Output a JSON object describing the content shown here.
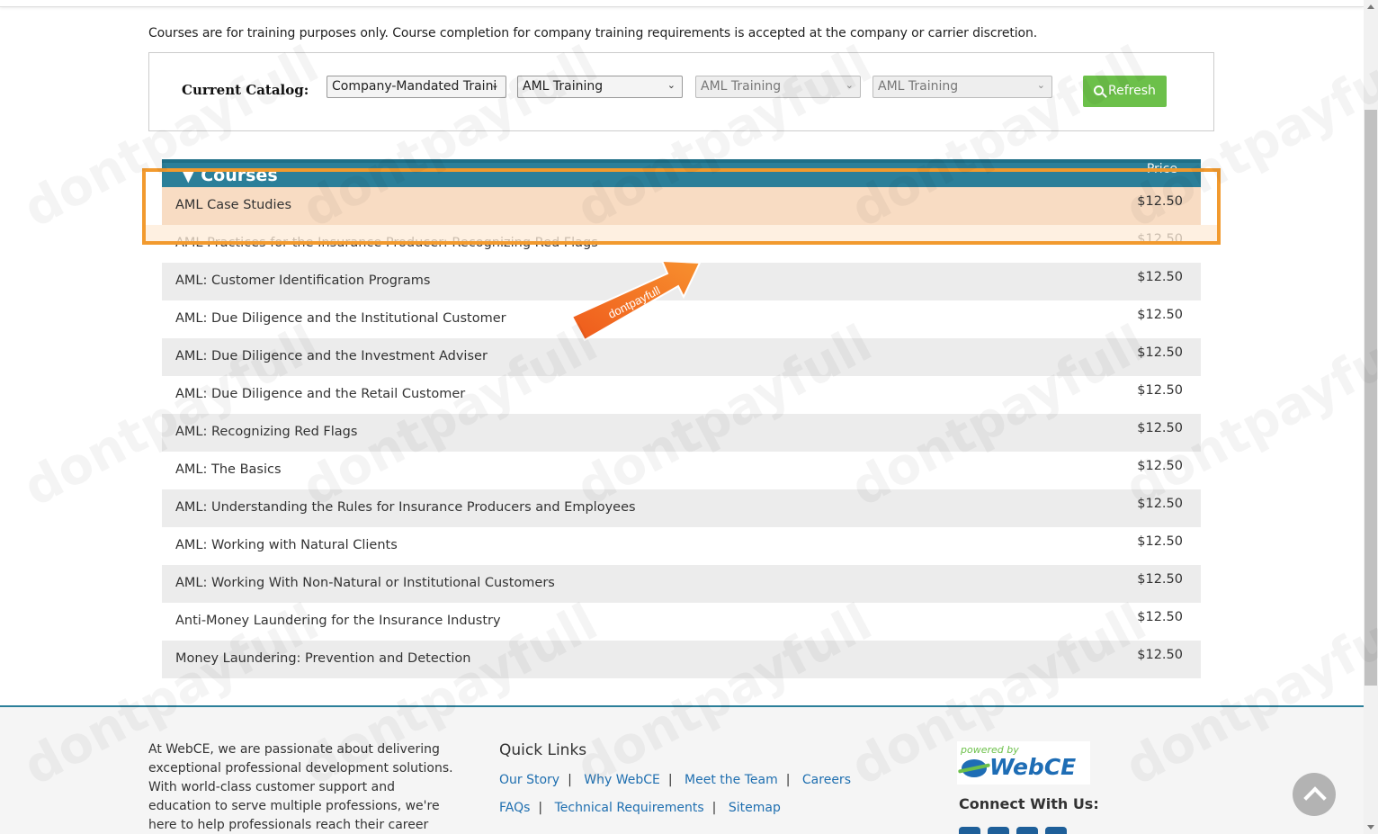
{
  "disclaimer": "Courses are for training purposes only. Course completion for company training requirements is accepted at the company or carrier discretion.",
  "catalog": {
    "label": "Current Catalog:",
    "selects": [
      {
        "value": "Company-Mandated Traini",
        "disabled": false
      },
      {
        "value": "AML Training",
        "disabled": false
      },
      {
        "value": "AML Training",
        "disabled": true
      },
      {
        "value": "AML Training",
        "disabled": true
      }
    ],
    "refresh_label": "Refresh"
  },
  "courses": {
    "title": "▼ Courses",
    "price_header": "Price",
    "items": [
      {
        "name": "AML Case Studies",
        "price": "$12.50"
      },
      {
        "name": "AML Practices for the Insurance Producer: Recognizing Red Flags",
        "price": "$12.50"
      },
      {
        "name": "AML: Customer Identification Programs",
        "price": "$12.50"
      },
      {
        "name": "AML: Due Diligence and the Institutional Customer",
        "price": "$12.50"
      },
      {
        "name": "AML: Due Diligence and the Investment Adviser",
        "price": "$12.50"
      },
      {
        "name": "AML: Due Diligence and the Retail Customer",
        "price": "$12.50"
      },
      {
        "name": "AML: Recognizing Red Flags",
        "price": "$12.50"
      },
      {
        "name": "AML: The Basics",
        "price": "$12.50"
      },
      {
        "name": "AML: Understanding the Rules for Insurance Producers and Employees",
        "price": "$12.50"
      },
      {
        "name": "AML: Working with Natural Clients",
        "price": "$12.50"
      },
      {
        "name": "AML: Working With Non-Natural or Institutional Customers",
        "price": "$12.50"
      },
      {
        "name": "Anti-Money Laundering for the Insurance Industry",
        "price": "$12.50"
      },
      {
        "name": "Money Laundering: Prevention and Detection",
        "price": "$12.50"
      }
    ]
  },
  "arrow_label": "dontpayfull",
  "watermark": "dontpayfull",
  "footer": {
    "about": "At WebCE, we are passionate about delivering exceptional professional development solutions. With world-class customer support and education to serve multiple professions, we're here to help professionals reach their career goals.",
    "quick_links_title": "Quick Links",
    "links_row1": [
      "Our Story",
      "Why WebCE",
      "Meet the Team",
      "Careers"
    ],
    "links_row2": [
      "FAQs",
      "Technical Requirements",
      "Sitemap"
    ],
    "powered_small": "powered by",
    "powered_brand": "WebCE",
    "connect_title": "Connect With Us:"
  },
  "icons": [
    "search-icon",
    "chevron-down-icon",
    "facebook-icon",
    "linkedin-icon",
    "youtube-icon",
    "instagram-icon",
    "chevron-up-icon"
  ],
  "colors": {
    "accent": "#2b7f99",
    "refresh": "#6cc04a",
    "highlight": "#f29a2e",
    "link": "#1f6fb0"
  }
}
